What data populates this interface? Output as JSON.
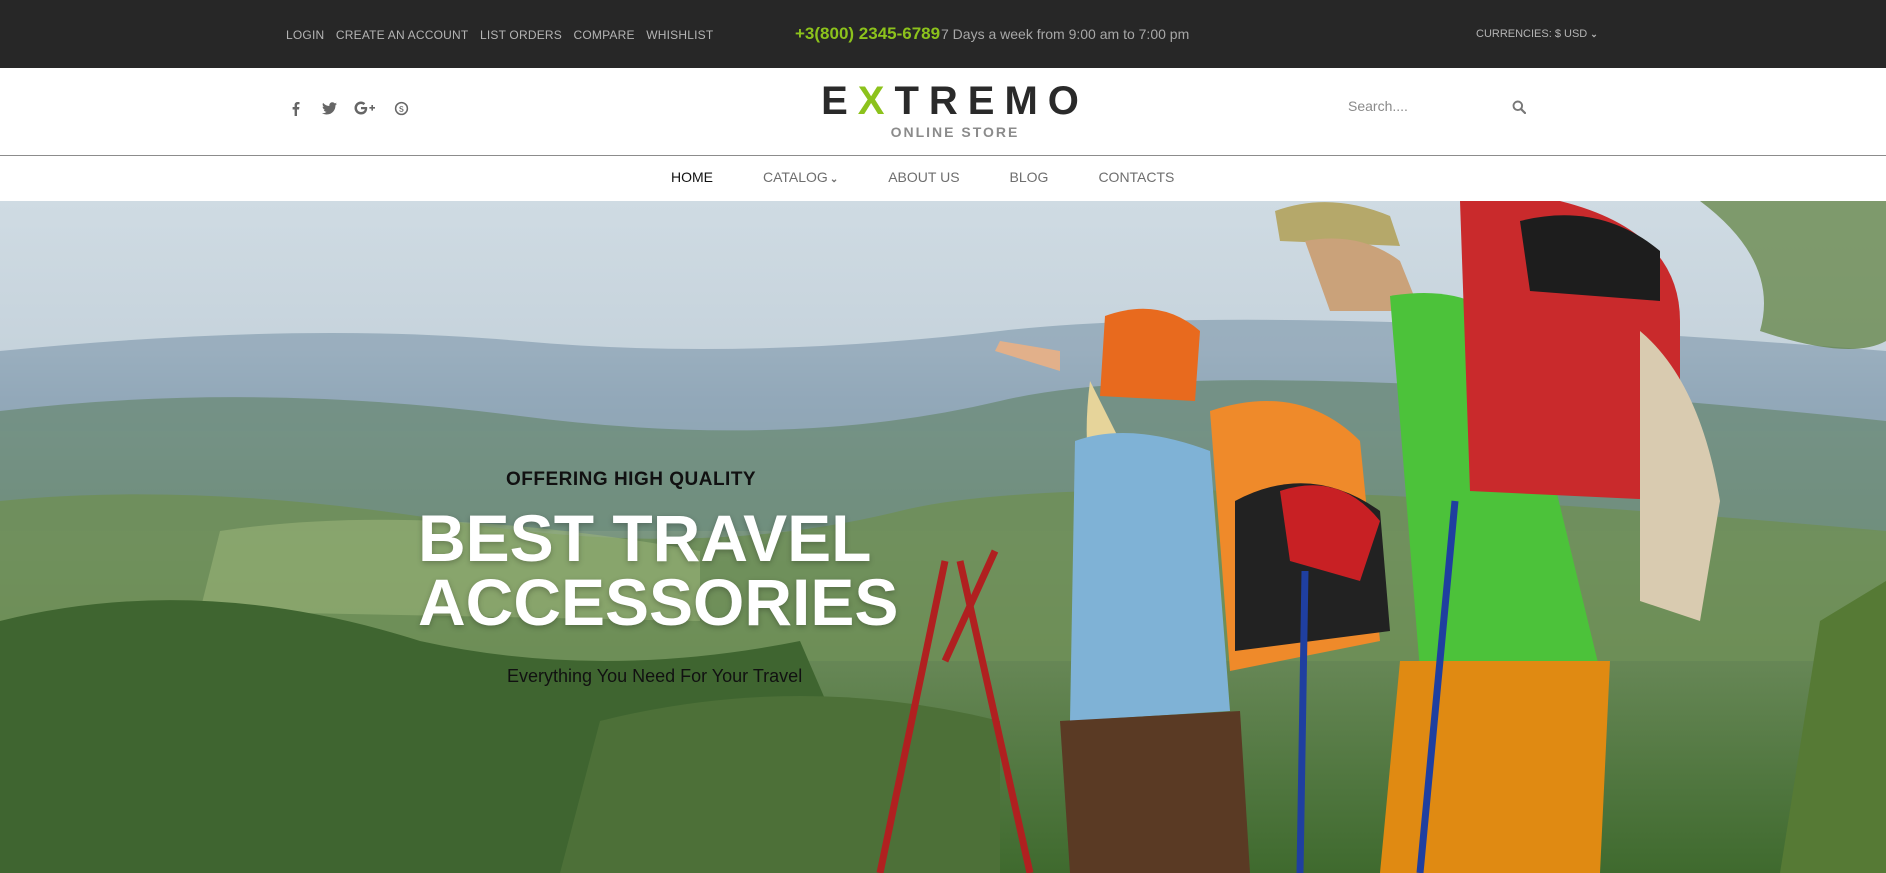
{
  "topbar": {
    "links": [
      "LOGIN",
      "CREATE AN ACCOUNT",
      "LIST ORDERS",
      "COMPARE",
      "WHISHLIST"
    ],
    "phone": "+3(800) 2345-6789",
    "hours": "7 Days a week from 9:00 am to 7:00 pm",
    "currency_label": "CURRENCIES: $ USD"
  },
  "header": {
    "social_icons": [
      "facebook-icon",
      "twitter-icon",
      "google-plus-icon",
      "skype-icon"
    ],
    "logo_left": "E",
    "logo_accent": "X",
    "logo_right": "TREMO",
    "logo_subtitle": "ONLINE STORE",
    "search_placeholder": "Search...."
  },
  "nav": {
    "items": [
      "HOME",
      "CATALOG",
      "ABOUT US",
      "BLOG",
      "CONTACTS"
    ],
    "active": "HOME"
  },
  "hero": {
    "kicker": "OFFERING HIGH QUALITY",
    "title_line1": "BEST TRAVEL",
    "title_line2": "ACCESSORIES",
    "subtitle": "Everything You Need For Your Travel"
  },
  "colors": {
    "accent": "#8cc21c",
    "topbar_bg": "#272727"
  }
}
